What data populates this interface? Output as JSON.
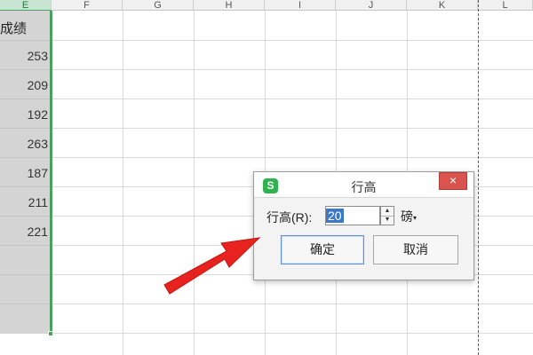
{
  "spreadsheet": {
    "columns": [
      {
        "label": "E",
        "selected": true
      },
      {
        "label": "F",
        "selected": false
      },
      {
        "label": "G",
        "selected": false
      },
      {
        "label": "H",
        "selected": false
      },
      {
        "label": "I",
        "selected": false
      },
      {
        "label": "J",
        "selected": false
      },
      {
        "label": "K",
        "selected": false
      },
      {
        "label": "L",
        "selected": false
      }
    ],
    "header_cell": "成绩",
    "values": [
      "253",
      "209",
      "192",
      "263",
      "187",
      "211",
      "221"
    ]
  },
  "dialog": {
    "title": "行高",
    "logo": "S",
    "close": "×",
    "row_height_label": "行高(R):",
    "row_height_value": "20",
    "unit": "磅",
    "unit_arrow": "▾",
    "spin_up": "▲",
    "spin_down": "▼",
    "ok_label": "确定",
    "cancel_label": "取消"
  },
  "colors": {
    "selection_border": "#4aa05d",
    "arrow": "#e8231f",
    "close_button": "#d9534f",
    "input_selection": "#3a78c9"
  }
}
